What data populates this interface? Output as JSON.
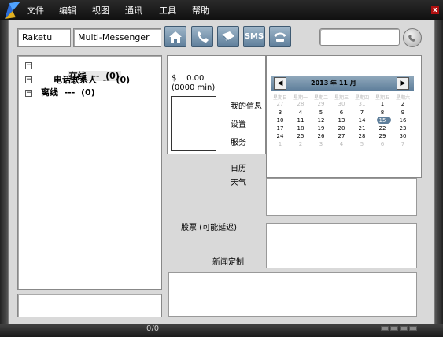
{
  "menu": [
    "文件",
    "编辑",
    "视图",
    "通讯",
    "工具",
    "帮助"
  ],
  "window": {
    "close_label": "x"
  },
  "account": {
    "user": "Raketu",
    "network": "Multi-Messenger"
  },
  "toolbar": {
    "sms_label": "SMS"
  },
  "search": {
    "value": "",
    "placeholder": ""
  },
  "contacts": {
    "groups": [
      {
        "label": "在线  --  (0)",
        "toggle": "−"
      },
      {
        "label": "电话联系人  --  (0)",
        "toggle": "−"
      },
      {
        "label": "离线  ---  (0)",
        "toggle": "−"
      }
    ]
  },
  "account_info": {
    "balance": "$    0.00",
    "minutes": "(0000 min)"
  },
  "side_links": [
    "我的信息",
    "设置",
    "服务",
    "日历",
    "天气"
  ],
  "calendar": {
    "title": "2013 年 11 月",
    "weekdays": [
      "星期日",
      "星期一",
      "星期二",
      "星期三",
      "星期四",
      "星期五",
      "星期六"
    ],
    "weeks": [
      [
        "27",
        "28",
        "29",
        "30",
        "31",
        "1",
        "2"
      ],
      [
        "3",
        "4",
        "5",
        "6",
        "7",
        "8",
        "9"
      ],
      [
        "10",
        "11",
        "12",
        "13",
        "14",
        "15",
        "16"
      ],
      [
        "17",
        "18",
        "19",
        "20",
        "21",
        "22",
        "23"
      ],
      [
        "24",
        "25",
        "26",
        "27",
        "28",
        "29",
        "30"
      ],
      [
        "1",
        "2",
        "3",
        "4",
        "5",
        "6",
        "7"
      ]
    ],
    "today": "15"
  },
  "sections": {
    "stocks": "股票 (可能延迟)",
    "news": "新闻定制"
  },
  "status": {
    "count": "0/0"
  },
  "colors": {
    "title_bar": "#1a1a1a",
    "button": "#5f7f9b",
    "calendar_header": "#6f8ba3"
  }
}
